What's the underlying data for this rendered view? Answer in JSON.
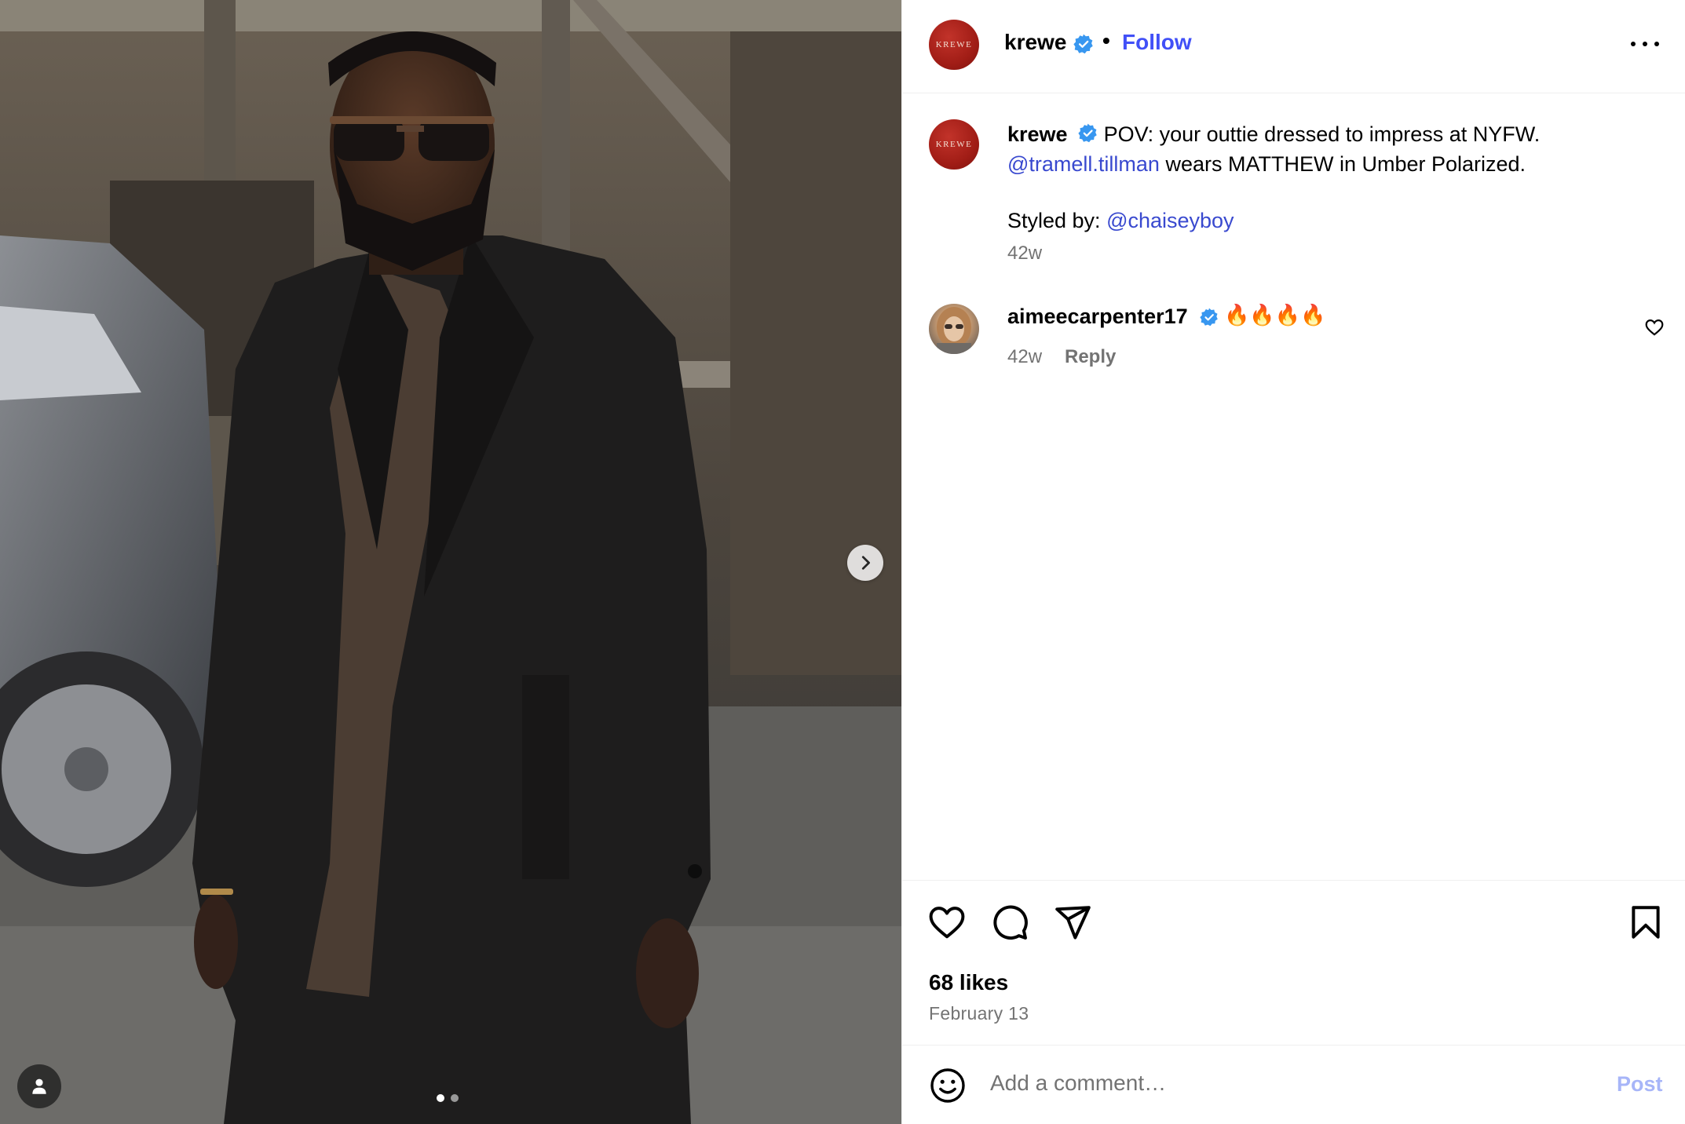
{
  "post": {
    "username": "krewe",
    "follow_label": "Follow",
    "separator": "•",
    "avatar_text": "KREWE",
    "more_icon": "more-horizontal-icon",
    "carousel": {
      "active_index": 0,
      "total": 2
    }
  },
  "caption": {
    "username": "krewe",
    "text_1": " POV: your outtie dressed to impress at NYFW.",
    "mention_1": "@tramell.tillman",
    "text_2": " wears MATTHEW in Umber Polarized.",
    "styled_by": "Styled by: ",
    "mention_2": "@chaiseyboy",
    "time": "42w"
  },
  "comments": [
    {
      "username": "aimeecarpenter17",
      "text": "🔥🔥🔥🔥",
      "time": "42w",
      "reply_label": "Reply"
    }
  ],
  "actions": {
    "likes": "68 likes",
    "date": "February 13",
    "icons": [
      "heart-icon",
      "comment-icon",
      "share-icon",
      "bookmark-icon"
    ]
  },
  "composer": {
    "placeholder": "Add a comment…",
    "post_label": "Post"
  },
  "colors": {
    "link": "#4150f7",
    "mention": "#3949cf",
    "verified": "#3897f0",
    "secondary_text": "#737373",
    "post_disabled": "#a7b5f8",
    "avatar_red": "#a11d16"
  }
}
